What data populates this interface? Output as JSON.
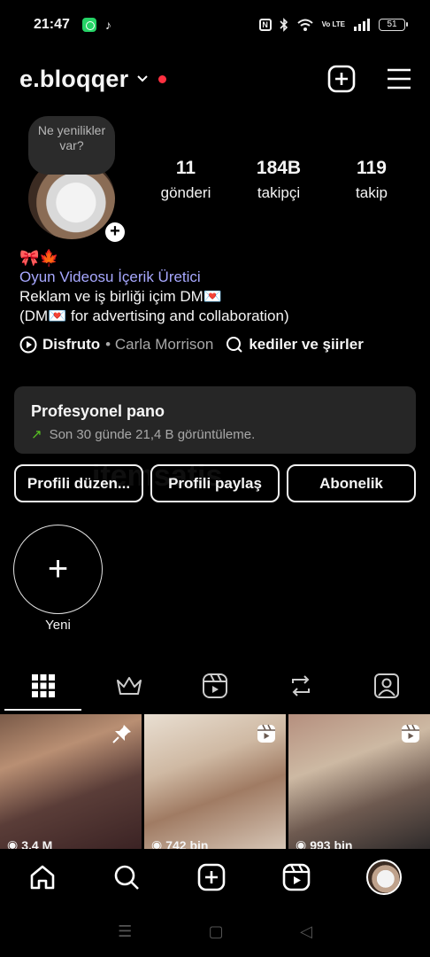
{
  "status_bar": {
    "time": "21:47",
    "tiktok_glyph": "♪",
    "nfc": "N",
    "volte": "Vo LTE",
    "battery": "51"
  },
  "header": {
    "username": "e.bloqqer",
    "icons": [
      "chevron-down-icon",
      "new-post-icon",
      "menu-icon"
    ]
  },
  "profile": {
    "note": "Ne yenilikler var?",
    "stats": [
      {
        "value": "11",
        "label": "gönderi"
      },
      {
        "value": "184B",
        "label": "takipçi"
      },
      {
        "value": "119",
        "label": "takip"
      }
    ],
    "bio": {
      "emoji": "🎀🍁",
      "category": "Oyun Videosu İçerik Üretici",
      "line1": "Reklam ve iş birliği içim DM💌",
      "line2": "(DM💌 for advertising and collaboration)",
      "song": "Disfruto",
      "artist": "• Carla Morrison",
      "topic": "kediler ve şiirler"
    }
  },
  "pro_dashboard": {
    "title": "Profesyonel pano",
    "subtitle": "Son 30 günde 21,4 B görüntüleme."
  },
  "buttons": {
    "edit": "Profili düzen...",
    "share": "Profili paylaş",
    "subscription": "Abonelik"
  },
  "highlights": {
    "new_label": "Yeni",
    "plus": "+"
  },
  "posts": [
    {
      "views": "3,4 M",
      "badge": "pin-icon"
    },
    {
      "views": "742 bin",
      "badge": "reels-icon"
    },
    {
      "views": "993 bin",
      "badge": "reels-icon"
    }
  ],
  "watermark": "itemsatis"
}
